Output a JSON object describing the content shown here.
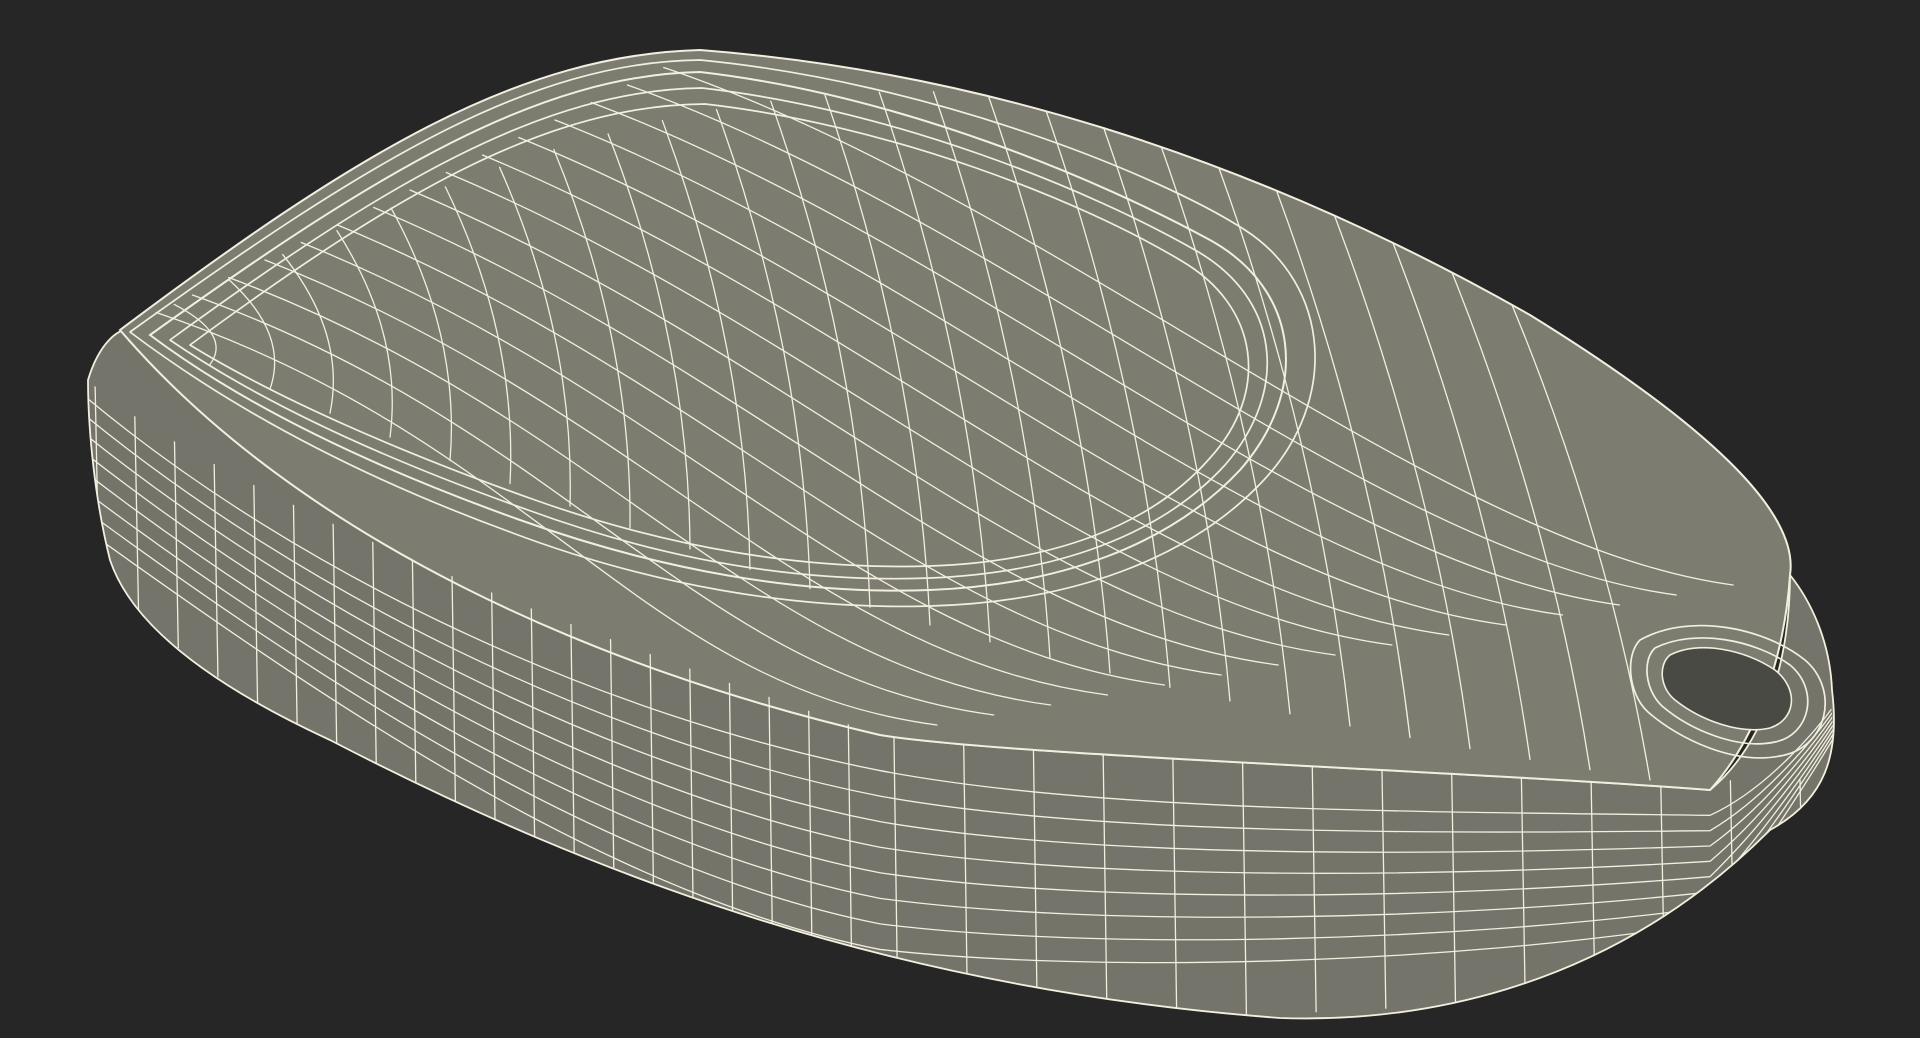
{
  "scene": {
    "subject": "wireframe-3d-model",
    "background_color": "#262626",
    "surface_color": "#7c7c70",
    "surface_side_color": "#74746a",
    "wire_color": "#f2efdf",
    "recess_color": "#4a4a44"
  }
}
